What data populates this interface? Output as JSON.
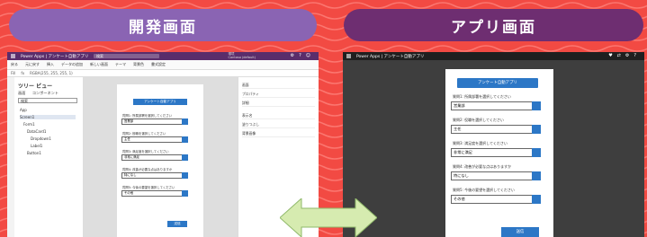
{
  "header": {
    "dev_label": "開発画面",
    "app_label": "アプリ画面"
  },
  "app_title": "Power Apps | アンケート自動アプリ",
  "search_placeholder": "検索",
  "environment_label": "環境",
  "environment_value": "Contoso (default)",
  "ribbon": {
    "items": [
      "戻る",
      "元に戻す",
      "挿入",
      "データの追加",
      "新しい画面",
      "テーマ",
      "背景色",
      "書式設定"
    ]
  },
  "formula": {
    "property": "Fill",
    "expression": "RGBA(255, 255, 255, 1)"
  },
  "tree": {
    "title": "ツリー ビュー",
    "tab_screens": "画面",
    "tab_components": "コンポーネント",
    "search_placeholder": "検索",
    "nodes": [
      "App",
      "Screen1",
      "Form1",
      "DataCard1",
      "Dropdown1",
      "Label1",
      "Button1"
    ]
  },
  "form": {
    "title": "アンケート自動アプリ",
    "questions": [
      {
        "label": "質問1: 所属部署を選択してください",
        "value": "営業部"
      },
      {
        "label": "質問2: 役職を選択してください",
        "value": "主任"
      },
      {
        "label": "質問3: 満足度を選択してください",
        "value": "非常に満足"
      },
      {
        "label": "質問4: 改善が必要な点はありますか",
        "value": "特になし"
      },
      {
        "label": "質問5: 今後の要望を選択してください",
        "value": "その他"
      }
    ],
    "submit_label": "送信"
  },
  "props": {
    "rows": [
      "画面",
      "プロパティ",
      "詳細",
      "表示名",
      "塗りつぶし",
      "背景画像"
    ]
  },
  "colors": {
    "background": "#f24a43",
    "dev_pill": "#8a64b3",
    "app_pill": "#6e2e71",
    "arrow": "#d6ebb0",
    "accent": "#2c77c6"
  }
}
